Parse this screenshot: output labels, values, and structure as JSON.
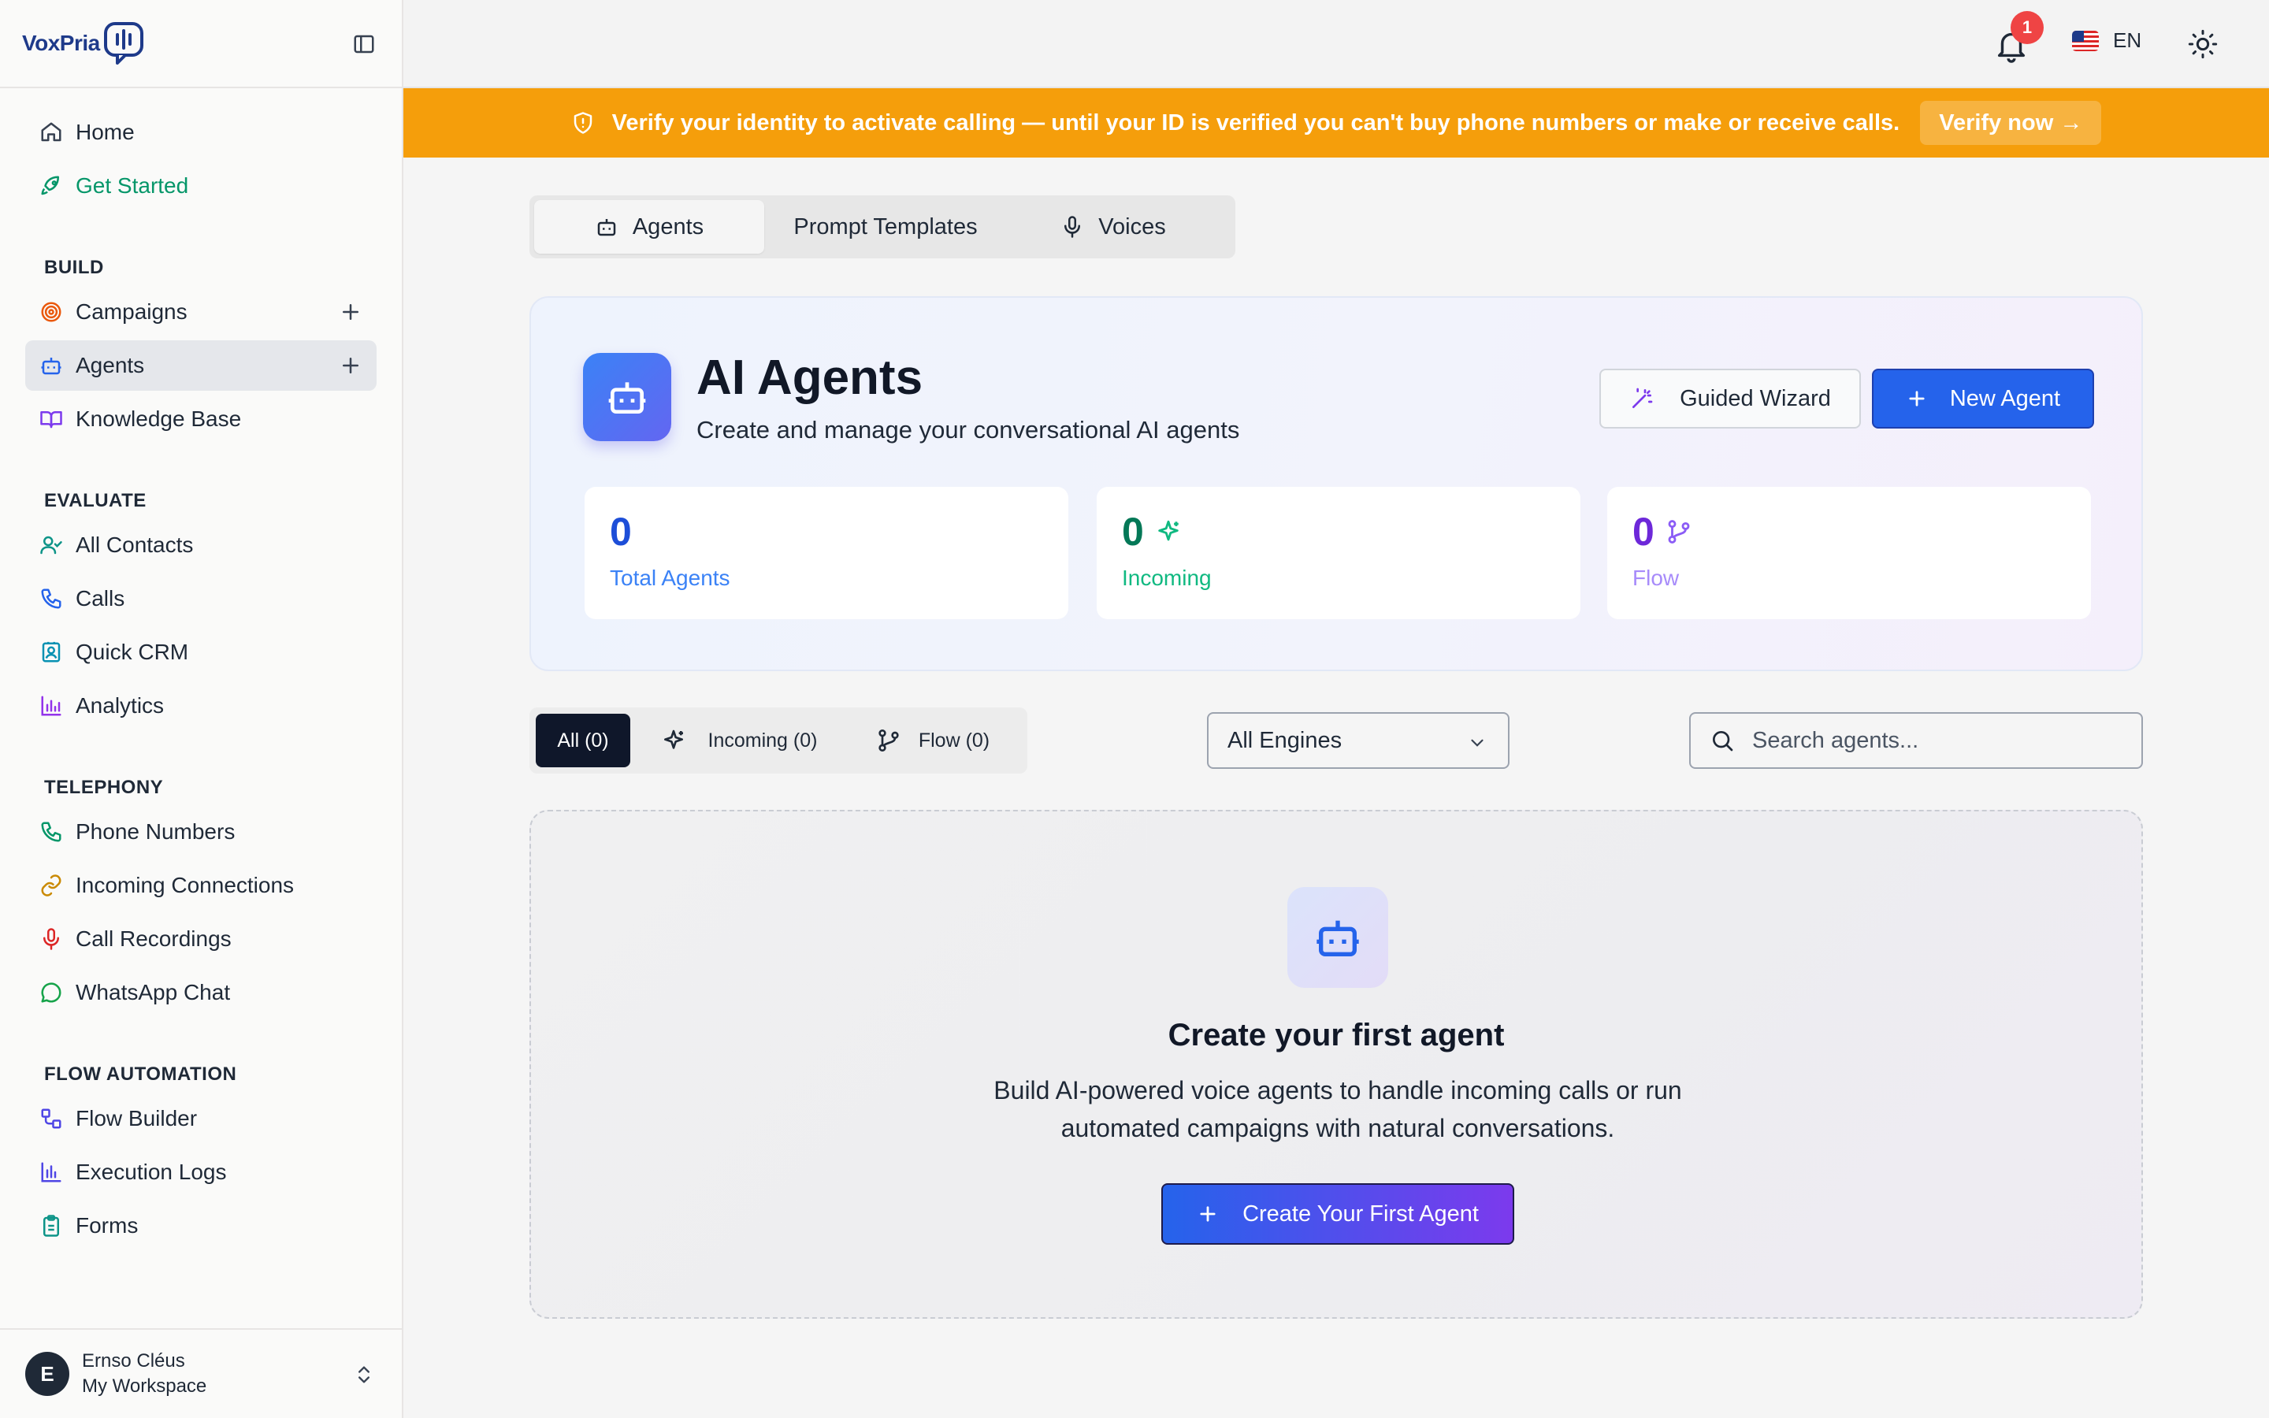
{
  "brand": {
    "name": "VoxPria"
  },
  "sidebar": {
    "top_items": [
      {
        "label": "Home",
        "icon": "home-icon"
      },
      {
        "label": "Get Started",
        "icon": "rocket-icon",
        "color": "#059669"
      }
    ],
    "sections": [
      {
        "title": "BUILD",
        "items": [
          {
            "label": "Campaigns",
            "icon": "target-icon",
            "has_add": true
          },
          {
            "label": "Agents",
            "icon": "bot-icon",
            "has_add": true,
            "active": true
          },
          {
            "label": "Knowledge Base",
            "icon": "book-icon"
          }
        ]
      },
      {
        "title": "EVALUATE",
        "items": [
          {
            "label": "All Contacts",
            "icon": "user-check-icon"
          },
          {
            "label": "Calls",
            "icon": "phone-icon"
          },
          {
            "label": "Quick CRM",
            "icon": "contact-card-icon"
          },
          {
            "label": "Analytics",
            "icon": "bar-chart-icon"
          }
        ]
      },
      {
        "title": "TELEPHONY",
        "items": [
          {
            "label": "Phone Numbers",
            "icon": "phone-icon"
          },
          {
            "label": "Incoming Connections",
            "icon": "link-icon"
          },
          {
            "label": "Call Recordings",
            "icon": "mic-icon"
          },
          {
            "label": "WhatsApp Chat",
            "icon": "chat-bubble-icon"
          }
        ]
      },
      {
        "title": "FLOW AUTOMATION",
        "items": [
          {
            "label": "Flow Builder",
            "icon": "workflow-icon"
          },
          {
            "label": "Execution Logs",
            "icon": "bar-chart-icon"
          },
          {
            "label": "Forms",
            "icon": "clipboard-icon"
          }
        ]
      }
    ],
    "user": {
      "initial": "E",
      "name": "Ernso Cléus",
      "workspace": "My Workspace"
    }
  },
  "topbar": {
    "notification_count": "1",
    "language": "EN"
  },
  "banner": {
    "text": "Verify your identity to activate calling — until your ID is verified you can't buy phone numbers or make or receive calls.",
    "cta": "Verify now →",
    "color": "#f59e0b"
  },
  "tabs": [
    {
      "label": "Agents",
      "active": true
    },
    {
      "label": "Prompt Templates"
    },
    {
      "label": "Voices"
    }
  ],
  "hero": {
    "title": "AI Agents",
    "subtitle": "Create and manage your conversational AI agents",
    "wizard_label": "Guided Wizard",
    "new_agent_label": "New Agent"
  },
  "stats": [
    {
      "value": "0",
      "label": "Total Agents",
      "color": "#1d4ed8",
      "label_color": "#3b82f6"
    },
    {
      "value": "0",
      "label": "Incoming",
      "color": "#047857",
      "label_color": "#10b981"
    },
    {
      "value": "0",
      "label": "Flow",
      "color": "#6d28d9",
      "label_color": "#a78bfa"
    }
  ],
  "filters": {
    "all": "All (0)",
    "incoming": "Incoming (0)",
    "flow": "Flow (0)",
    "engine_selected": "All Engines",
    "search_placeholder": "Search agents..."
  },
  "empty_state": {
    "title": "Create your first agent",
    "description": "Build AI-powered voice agents to handle incoming calls or run automated campaigns with natural conversations.",
    "cta": "Create Your First Agent"
  }
}
